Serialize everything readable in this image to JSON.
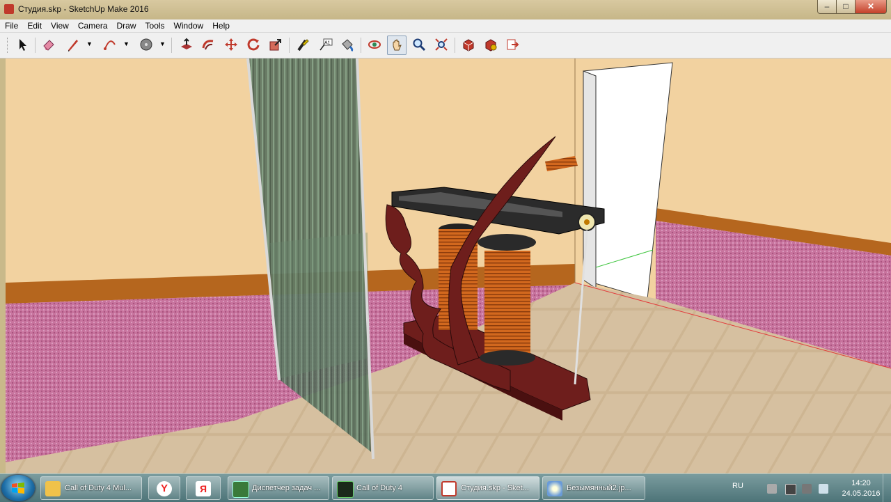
{
  "window": {
    "title": "Студия.skp - SketchUp Make 2016",
    "controls": {
      "minimize": "–",
      "maximize": "□",
      "close": "✕"
    }
  },
  "menu": [
    "File",
    "Edit",
    "View",
    "Camera",
    "Draw",
    "Tools",
    "Window",
    "Help"
  ],
  "toolbar": {
    "tools": [
      {
        "name": "select-tool-icon"
      },
      {
        "name": "eraser-tool-icon"
      },
      {
        "name": "line-tool-icon",
        "dropdown": true
      },
      {
        "name": "arc-tool-icon",
        "dropdown": true
      },
      {
        "name": "shape-tool-icon",
        "dropdown": true
      },
      {
        "name": "push-pull-tool-icon"
      },
      {
        "name": "follow-me-tool-icon"
      },
      {
        "name": "move-tool-icon"
      },
      {
        "name": "rotate-tool-icon"
      },
      {
        "name": "scale-tool-icon"
      },
      {
        "name": "tape-measure-tool-icon"
      },
      {
        "name": "text-tool-icon"
      },
      {
        "name": "paint-bucket-tool-icon"
      },
      {
        "name": "orbit-tool-icon"
      },
      {
        "name": "pan-tool-icon",
        "active": true
      },
      {
        "name": "zoom-tool-icon"
      },
      {
        "name": "zoom-extents-tool-icon"
      },
      {
        "name": "3d-warehouse-icon"
      },
      {
        "name": "extension-warehouse-icon"
      },
      {
        "name": "send-to-layout-icon"
      }
    ],
    "text_tool_glyph": "A1"
  },
  "colors": {
    "wall": "#f2d2a0",
    "wallpaper": "#c8749e",
    "baseboard": "#b5661e",
    "floor": "#c8b08c",
    "machine_frame": "#6e1e1c",
    "coil": "#d2681e",
    "axis_red": "#e23b3b",
    "axis_green": "#3bc43b"
  },
  "taskbar": {
    "items": [
      {
        "name": "taskbar-explorer",
        "label": "Call of Duty 4 Mul..."
      },
      {
        "name": "taskbar-yandex-browser",
        "label": ""
      },
      {
        "name": "taskbar-yandex",
        "label": ""
      },
      {
        "name": "taskbar-task-manager",
        "label": "Диспетчер задач ..."
      },
      {
        "name": "taskbar-cod4",
        "label": "Call of Duty 4"
      },
      {
        "name": "taskbar-sketchup",
        "label": "Студия.skp - Sket...",
        "active": true
      },
      {
        "name": "taskbar-paint",
        "label": "Безымянный2.jp..."
      }
    ],
    "yandex_glyph": "Y",
    "yandex2_glyph": "Я",
    "tray": {
      "language": "RU",
      "time": "14:20",
      "date": "24.05.2016"
    }
  }
}
